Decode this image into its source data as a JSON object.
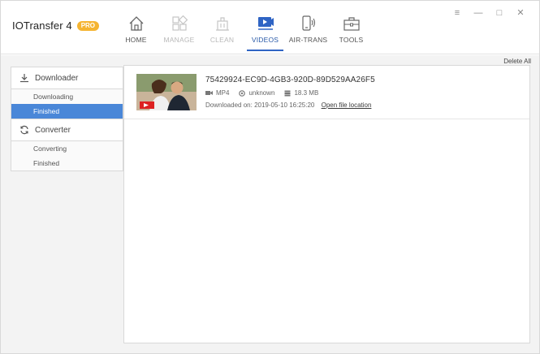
{
  "app": {
    "name": "IOTransfer 4",
    "badge": "PRO"
  },
  "nav": [
    {
      "label": "HOME",
      "icon": "home-icon",
      "state": "norm"
    },
    {
      "label": "MANAGE",
      "icon": "grid-icon",
      "state": "dim"
    },
    {
      "label": "CLEAN",
      "icon": "trash-icon",
      "state": "dim"
    },
    {
      "label": "VIDEOS",
      "icon": "video-icon",
      "state": "active"
    },
    {
      "label": "AIR-TRANS",
      "icon": "phone-wireless-icon",
      "state": "norm"
    },
    {
      "label": "TOOLS",
      "icon": "toolbox-icon",
      "state": "norm"
    }
  ],
  "window_controls": [
    "menu-icon",
    "minimize-icon",
    "maximize-icon",
    "close-icon"
  ],
  "toolbar": {
    "delete_all": "Delete All"
  },
  "sidebar": {
    "downloader": {
      "label": "Downloader",
      "icon": "download-icon",
      "items": [
        "Downloading",
        "Finished"
      ],
      "selected": "Finished"
    },
    "converter": {
      "label": "Converter",
      "icon": "sync-icon",
      "items": [
        "Converting",
        "Finished"
      ]
    }
  },
  "videos": [
    {
      "title": "75429924-EC9D-4GB3-920D-89D529AA26F5",
      "format": "MP4",
      "resolution": "unknown",
      "size": "18.3 MB",
      "downloaded_label": "Downloaded on:",
      "downloaded_on": "2019-05-10 16:25:20",
      "open_link": "Open file location"
    }
  ],
  "colors": {
    "accent": "#2f64c4",
    "selected": "#4a87d8",
    "badge": "#f5b431"
  }
}
